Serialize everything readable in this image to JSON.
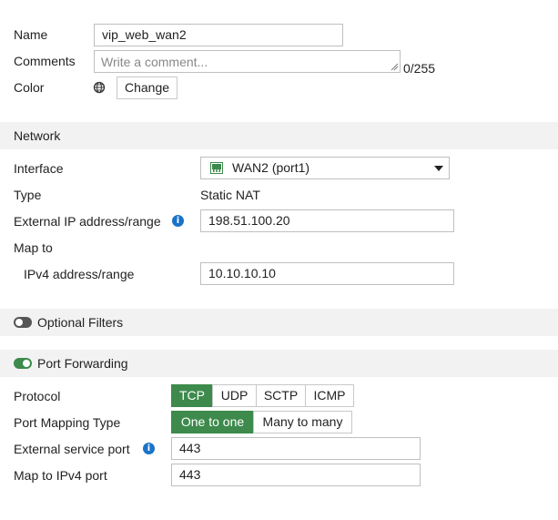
{
  "general": {
    "name_label": "Name",
    "name_value": "vip_web_wan2",
    "comments_label": "Comments",
    "comments_placeholder": "Write a comment...",
    "comments_counter": "0/255",
    "color_label": "Color",
    "change_button": "Change"
  },
  "network": {
    "section_title": "Network",
    "interface_label": "Interface",
    "interface_value": "WAN2 (port1)",
    "type_label": "Type",
    "type_value": "Static NAT",
    "external_ip_label": "External IP address/range",
    "external_ip_value": "198.51.100.20",
    "map_to_label": "Map to",
    "ipv4_label": "IPv4 address/range",
    "ipv4_value": "10.10.10.10"
  },
  "optional_filters": {
    "label": "Optional Filters",
    "enabled": false
  },
  "port_forwarding": {
    "label": "Port Forwarding",
    "enabled": true,
    "protocol_label": "Protocol",
    "protocols": [
      "TCP",
      "UDP",
      "SCTP",
      "ICMP"
    ],
    "protocol_selected": "TCP",
    "mapping_label": "Port Mapping Type",
    "mapping_options": [
      "One to one",
      "Many to many"
    ],
    "mapping_selected": "One to one",
    "external_port_label": "External service port",
    "external_port_value": "443",
    "map_port_label": "Map to IPv4 port",
    "map_port_value": "443"
  },
  "colors": {
    "accent_green": "#3d8a4c",
    "info_blue": "#1a73c9",
    "section_bg": "#f2f2f2"
  },
  "icons": {
    "color_icon": "globe-color-icon",
    "interface_icon": "network-port-icon",
    "dropdown_icon": "caret-down-icon",
    "info_icon": "info-icon"
  }
}
